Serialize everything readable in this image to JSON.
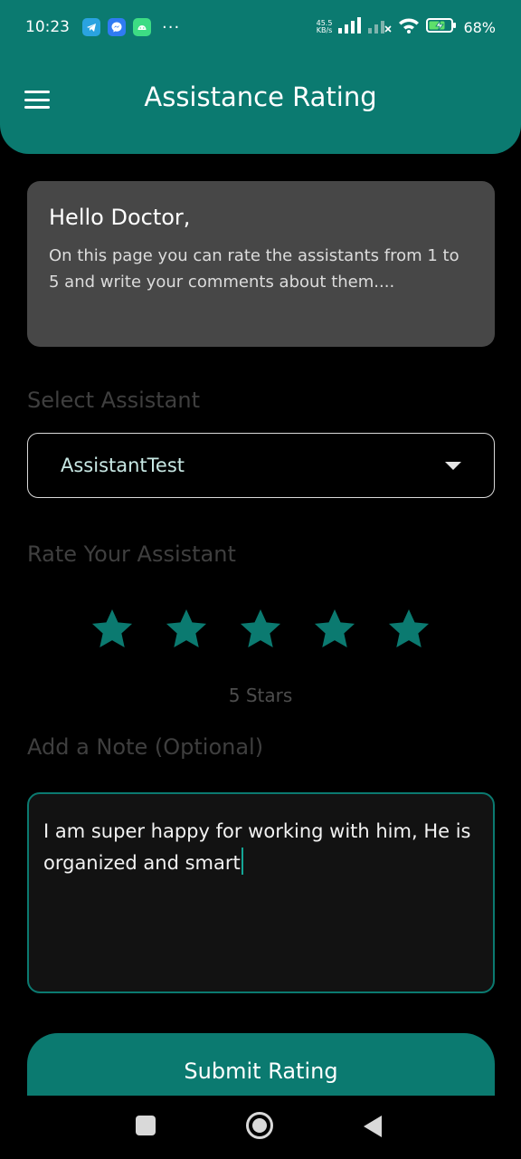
{
  "status_bar": {
    "time": "10:23",
    "notification_icons": [
      "telegram-icon",
      "messenger-icon",
      "android-icon"
    ],
    "more": "···",
    "net_speed_value": "45.5",
    "net_speed_unit": "KB/s",
    "battery": "68%"
  },
  "header": {
    "title": "Assistance Rating",
    "menu_icon": "hamburger-menu-icon"
  },
  "intro": {
    "title": "Hello Doctor,",
    "text": "On this page you can rate the assistants from 1 to 5 and write your comments about them...."
  },
  "assistant_select": {
    "label": "Select Assistant",
    "value": "AssistantTest"
  },
  "rating": {
    "label": "Rate Your Assistant",
    "max_stars": 5,
    "value": 5,
    "value_text": "5 Stars"
  },
  "note": {
    "label": "Add a Note (Optional)",
    "value": "I am super happy for working with him, He is organized and smart"
  },
  "submit": {
    "label": "Submit Rating"
  },
  "colors": {
    "accent": "#0b7a70",
    "card": "#474747",
    "background": "#000000"
  }
}
